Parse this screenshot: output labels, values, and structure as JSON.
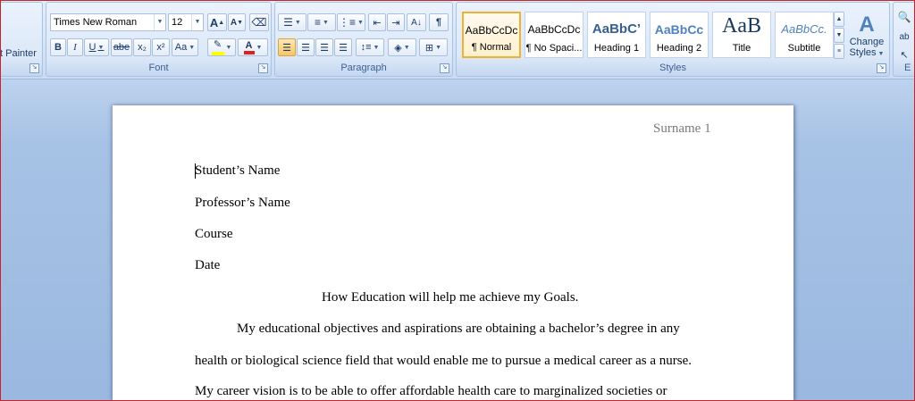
{
  "clipboard": {
    "format_painter_label": "t Painter"
  },
  "font": {
    "group_label": "Font",
    "font_name": "Times New Roman",
    "font_size": "12",
    "grow_label": "A",
    "shrink_label": "A",
    "bold": "B",
    "italic": "I",
    "underline": "U",
    "strike": "abe",
    "subscript": "x₂",
    "superscript": "x²",
    "change_case": "Aa",
    "font_color_label": "A"
  },
  "paragraph": {
    "group_label": "Paragraph",
    "sort_label": "A↓",
    "pilcrow": "¶"
  },
  "styles": {
    "group_label": "Styles",
    "tiles": [
      {
        "sample": "AaBbCcDc",
        "name": "¶ Normal"
      },
      {
        "sample": "AaBbCcDc",
        "name": "¶ No Spaci..."
      },
      {
        "sample": "AaBbC’",
        "name": "Heading 1"
      },
      {
        "sample": "AaBbCc",
        "name": "Heading 2"
      },
      {
        "sample": "AaB",
        "name": "Title"
      },
      {
        "sample": "AaBbCc.",
        "name": "Subtitle"
      }
    ],
    "change_styles_line1": "Change",
    "change_styles_line2": "Styles"
  },
  "editing": {
    "group_label": "E"
  },
  "document": {
    "header": "Surname 1",
    "lines": [
      "Student’s Name",
      "Professor’s Name",
      "Course",
      "Date"
    ],
    "title": "How Education will help me achieve my Goals.",
    "body": [
      "My educational objectives and aspirations are obtaining a bachelor’s degree in any",
      "health or biological  science  field that would enable me to pursue a medical career as a nurse.",
      "My career vision is to be able to offer affordable health care to marginalized societies  or"
    ]
  },
  "colors": {
    "accent_highlight": "#f8c56a",
    "font_color": "#e02020",
    "highlight_color": "#ffff00",
    "frame_border": "#c9242b"
  }
}
